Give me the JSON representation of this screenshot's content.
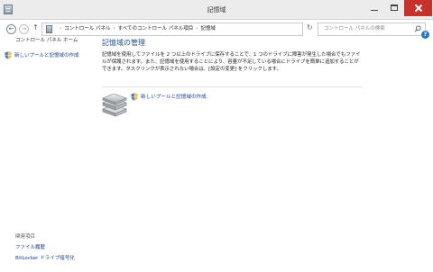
{
  "window": {
    "title": "記憶域"
  },
  "address_bar": {
    "crumbs": [
      "コントロール パネル",
      "すべてのコントロール パネル項目",
      "記憶域"
    ]
  },
  "search": {
    "placeholder": "コントロール パネルの検索"
  },
  "sidebar": {
    "heading": "コントロール パネル ホーム",
    "task": "新しいプールと記憶域の作成",
    "related_heading": "関連項目",
    "related_links": [
      "ファイル履歴",
      "BitLocker ドライブ暗号化"
    ]
  },
  "main": {
    "title": "記憶域の管理",
    "description": "記憶域を使用してファイルを 2 つ以上のドライブに保存することで、1 つのドライブに障害が発生した場合でもファイルが保護されます。また、記憶域を使用することにより、容量が不足している場合にドライブを簡単に追加することができます。タスクリンクが表示されない場合は、[設定の変更] をクリックします。",
    "create_link": "新しいプールと記憶域の作成"
  },
  "colors": {
    "link": "#1a3f8f",
    "title": "#1f4e8c",
    "close_button": "#c7312b"
  }
}
